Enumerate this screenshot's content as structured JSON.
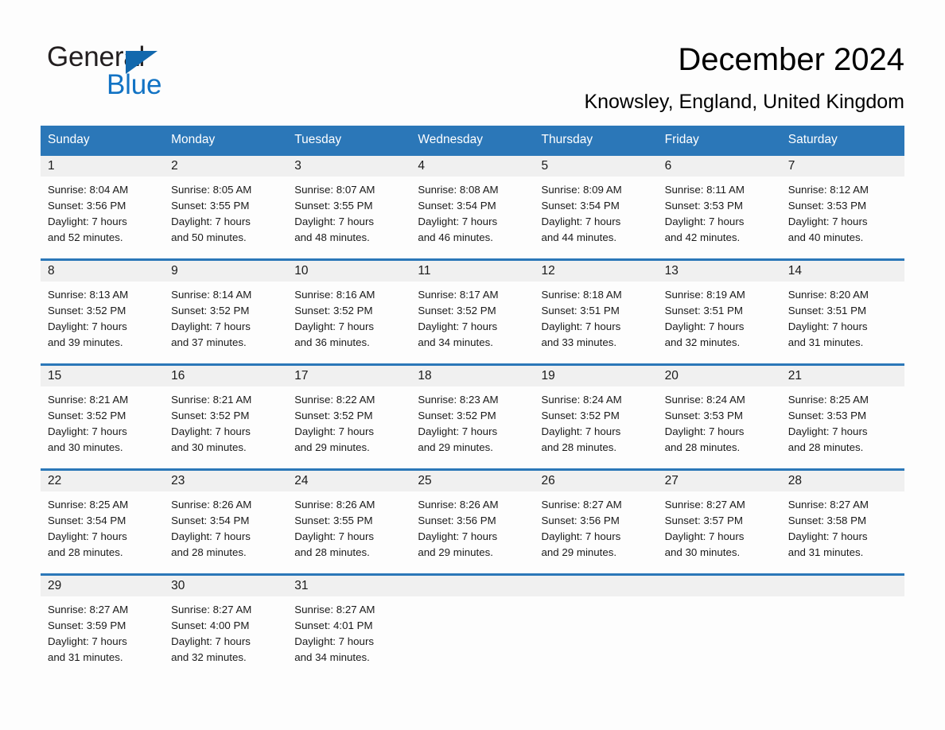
{
  "brand": {
    "name_part1": "General",
    "name_part2": "Blue",
    "triangle_color": "#1268ad",
    "blue_color": "#1273c4"
  },
  "header": {
    "title": "December 2024",
    "subtitle": "Knowsley, England, United Kingdom"
  },
  "theme": {
    "header_blue": "#2b77b8",
    "daynum_band": "#f0f0f0",
    "page_background": "#fdfdfd",
    "text": "#1a1a1a"
  },
  "weekday_headers": [
    "Sunday",
    "Monday",
    "Tuesday",
    "Wednesday",
    "Thursday",
    "Friday",
    "Saturday"
  ],
  "weeks": [
    {
      "days": [
        {
          "day": "1",
          "sunrise": "Sunrise: 8:04 AM",
          "sunset": "Sunset: 3:56 PM",
          "daylight_line1": "Daylight: 7 hours",
          "daylight_line2": "and 52 minutes."
        },
        {
          "day": "2",
          "sunrise": "Sunrise: 8:05 AM",
          "sunset": "Sunset: 3:55 PM",
          "daylight_line1": "Daylight: 7 hours",
          "daylight_line2": "and 50 minutes."
        },
        {
          "day": "3",
          "sunrise": "Sunrise: 8:07 AM",
          "sunset": "Sunset: 3:55 PM",
          "daylight_line1": "Daylight: 7 hours",
          "daylight_line2": "and 48 minutes."
        },
        {
          "day": "4",
          "sunrise": "Sunrise: 8:08 AM",
          "sunset": "Sunset: 3:54 PM",
          "daylight_line1": "Daylight: 7 hours",
          "daylight_line2": "and 46 minutes."
        },
        {
          "day": "5",
          "sunrise": "Sunrise: 8:09 AM",
          "sunset": "Sunset: 3:54 PM",
          "daylight_line1": "Daylight: 7 hours",
          "daylight_line2": "and 44 minutes."
        },
        {
          "day": "6",
          "sunrise": "Sunrise: 8:11 AM",
          "sunset": "Sunset: 3:53 PM",
          "daylight_line1": "Daylight: 7 hours",
          "daylight_line2": "and 42 minutes."
        },
        {
          "day": "7",
          "sunrise": "Sunrise: 8:12 AM",
          "sunset": "Sunset: 3:53 PM",
          "daylight_line1": "Daylight: 7 hours",
          "daylight_line2": "and 40 minutes."
        }
      ]
    },
    {
      "days": [
        {
          "day": "8",
          "sunrise": "Sunrise: 8:13 AM",
          "sunset": "Sunset: 3:52 PM",
          "daylight_line1": "Daylight: 7 hours",
          "daylight_line2": "and 39 minutes."
        },
        {
          "day": "9",
          "sunrise": "Sunrise: 8:14 AM",
          "sunset": "Sunset: 3:52 PM",
          "daylight_line1": "Daylight: 7 hours",
          "daylight_line2": "and 37 minutes."
        },
        {
          "day": "10",
          "sunrise": "Sunrise: 8:16 AM",
          "sunset": "Sunset: 3:52 PM",
          "daylight_line1": "Daylight: 7 hours",
          "daylight_line2": "and 36 minutes."
        },
        {
          "day": "11",
          "sunrise": "Sunrise: 8:17 AM",
          "sunset": "Sunset: 3:52 PM",
          "daylight_line1": "Daylight: 7 hours",
          "daylight_line2": "and 34 minutes."
        },
        {
          "day": "12",
          "sunrise": "Sunrise: 8:18 AM",
          "sunset": "Sunset: 3:51 PM",
          "daylight_line1": "Daylight: 7 hours",
          "daylight_line2": "and 33 minutes."
        },
        {
          "day": "13",
          "sunrise": "Sunrise: 8:19 AM",
          "sunset": "Sunset: 3:51 PM",
          "daylight_line1": "Daylight: 7 hours",
          "daylight_line2": "and 32 minutes."
        },
        {
          "day": "14",
          "sunrise": "Sunrise: 8:20 AM",
          "sunset": "Sunset: 3:51 PM",
          "daylight_line1": "Daylight: 7 hours",
          "daylight_line2": "and 31 minutes."
        }
      ]
    },
    {
      "days": [
        {
          "day": "15",
          "sunrise": "Sunrise: 8:21 AM",
          "sunset": "Sunset: 3:52 PM",
          "daylight_line1": "Daylight: 7 hours",
          "daylight_line2": "and 30 minutes."
        },
        {
          "day": "16",
          "sunrise": "Sunrise: 8:21 AM",
          "sunset": "Sunset: 3:52 PM",
          "daylight_line1": "Daylight: 7 hours",
          "daylight_line2": "and 30 minutes."
        },
        {
          "day": "17",
          "sunrise": "Sunrise: 8:22 AM",
          "sunset": "Sunset: 3:52 PM",
          "daylight_line1": "Daylight: 7 hours",
          "daylight_line2": "and 29 minutes."
        },
        {
          "day": "18",
          "sunrise": "Sunrise: 8:23 AM",
          "sunset": "Sunset: 3:52 PM",
          "daylight_line1": "Daylight: 7 hours",
          "daylight_line2": "and 29 minutes."
        },
        {
          "day": "19",
          "sunrise": "Sunrise: 8:24 AM",
          "sunset": "Sunset: 3:52 PM",
          "daylight_line1": "Daylight: 7 hours",
          "daylight_line2": "and 28 minutes."
        },
        {
          "day": "20",
          "sunrise": "Sunrise: 8:24 AM",
          "sunset": "Sunset: 3:53 PM",
          "daylight_line1": "Daylight: 7 hours",
          "daylight_line2": "and 28 minutes."
        },
        {
          "day": "21",
          "sunrise": "Sunrise: 8:25 AM",
          "sunset": "Sunset: 3:53 PM",
          "daylight_line1": "Daylight: 7 hours",
          "daylight_line2": "and 28 minutes."
        }
      ]
    },
    {
      "days": [
        {
          "day": "22",
          "sunrise": "Sunrise: 8:25 AM",
          "sunset": "Sunset: 3:54 PM",
          "daylight_line1": "Daylight: 7 hours",
          "daylight_line2": "and 28 minutes."
        },
        {
          "day": "23",
          "sunrise": "Sunrise: 8:26 AM",
          "sunset": "Sunset: 3:54 PM",
          "daylight_line1": "Daylight: 7 hours",
          "daylight_line2": "and 28 minutes."
        },
        {
          "day": "24",
          "sunrise": "Sunrise: 8:26 AM",
          "sunset": "Sunset: 3:55 PM",
          "daylight_line1": "Daylight: 7 hours",
          "daylight_line2": "and 28 minutes."
        },
        {
          "day": "25",
          "sunrise": "Sunrise: 8:26 AM",
          "sunset": "Sunset: 3:56 PM",
          "daylight_line1": "Daylight: 7 hours",
          "daylight_line2": "and 29 minutes."
        },
        {
          "day": "26",
          "sunrise": "Sunrise: 8:27 AM",
          "sunset": "Sunset: 3:56 PM",
          "daylight_line1": "Daylight: 7 hours",
          "daylight_line2": "and 29 minutes."
        },
        {
          "day": "27",
          "sunrise": "Sunrise: 8:27 AM",
          "sunset": "Sunset: 3:57 PM",
          "daylight_line1": "Daylight: 7 hours",
          "daylight_line2": "and 30 minutes."
        },
        {
          "day": "28",
          "sunrise": "Sunrise: 8:27 AM",
          "sunset": "Sunset: 3:58 PM",
          "daylight_line1": "Daylight: 7 hours",
          "daylight_line2": "and 31 minutes."
        }
      ]
    },
    {
      "days": [
        {
          "day": "29",
          "sunrise": "Sunrise: 8:27 AM",
          "sunset": "Sunset: 3:59 PM",
          "daylight_line1": "Daylight: 7 hours",
          "daylight_line2": "and 31 minutes."
        },
        {
          "day": "30",
          "sunrise": "Sunrise: 8:27 AM",
          "sunset": "Sunset: 4:00 PM",
          "daylight_line1": "Daylight: 7 hours",
          "daylight_line2": "and 32 minutes."
        },
        {
          "day": "31",
          "sunrise": "Sunrise: 8:27 AM",
          "sunset": "Sunset: 4:01 PM",
          "daylight_line1": "Daylight: 7 hours",
          "daylight_line2": "and 34 minutes."
        },
        {
          "day": "",
          "sunrise": "",
          "sunset": "",
          "daylight_line1": "",
          "daylight_line2": ""
        },
        {
          "day": "",
          "sunrise": "",
          "sunset": "",
          "daylight_line1": "",
          "daylight_line2": ""
        },
        {
          "day": "",
          "sunrise": "",
          "sunset": "",
          "daylight_line1": "",
          "daylight_line2": ""
        },
        {
          "day": "",
          "sunrise": "",
          "sunset": "",
          "daylight_line1": "",
          "daylight_line2": ""
        }
      ]
    }
  ]
}
